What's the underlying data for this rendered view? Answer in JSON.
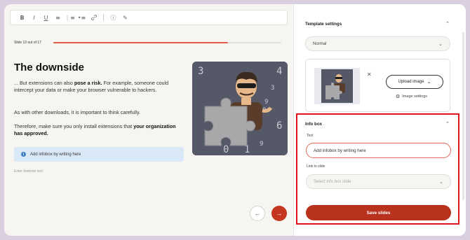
{
  "toolbar": {
    "buttons": [
      {
        "name": "bold-button",
        "glyph": "B"
      },
      {
        "name": "italic-button",
        "glyph": "I"
      },
      {
        "name": "underline-button",
        "glyph": "U"
      },
      {
        "name": "align-button",
        "glyph": "≡"
      },
      {
        "name": "numbered-list-button",
        "glyph": "⋮≡"
      },
      {
        "name": "bullet-list-button",
        "glyph": "•≡"
      },
      {
        "name": "link-button",
        "glyph": "🔗"
      },
      {
        "name": "info-button",
        "glyph": "ⓘ"
      },
      {
        "name": "pen-button",
        "glyph": "✎"
      }
    ]
  },
  "progress": {
    "label": "Slide 13 out of 17",
    "current": 13,
    "total": 17
  },
  "slide": {
    "title": "The downside",
    "p1_pre": "... But extensions can also ",
    "p1_bold": "pose a risk.",
    "p1_post": " For example, someone could intercept your data or make your browser vulnerable to hackers.",
    "p2": "As with other downloads, it is important to think carefully.",
    "p3_pre": "Therefore, make sure you only install extensions that ",
    "p3_bold": "your organization has approved.",
    "infobox_text": "Add infobox by writing here",
    "footnote_placeholder": "Enter footnote text",
    "image_digits": [
      "3",
      "4",
      "3",
      "9",
      "0",
      "0",
      "0",
      "1",
      "9",
      "6"
    ]
  },
  "nav": {
    "prev_glyph": "←",
    "next_glyph": "→"
  },
  "sidebar": {
    "template_settings": {
      "title": "Template settings",
      "layout_value": "Normal",
      "close_glyph": "✕",
      "upload_label": "Upload image",
      "image_settings_label": "Image settings"
    },
    "info_box": {
      "title": "Info box",
      "text_label": "Text",
      "text_value": "Add infobox by writing here",
      "link_label": "Link to slide",
      "link_placeholder": "Select info box slide",
      "save_label": "Save slides"
    }
  },
  "colors": {
    "accent": "#c43620",
    "progress": "#e25a45",
    "highlight": "#e0161f",
    "infobox_bg": "#d9e8f6"
  }
}
